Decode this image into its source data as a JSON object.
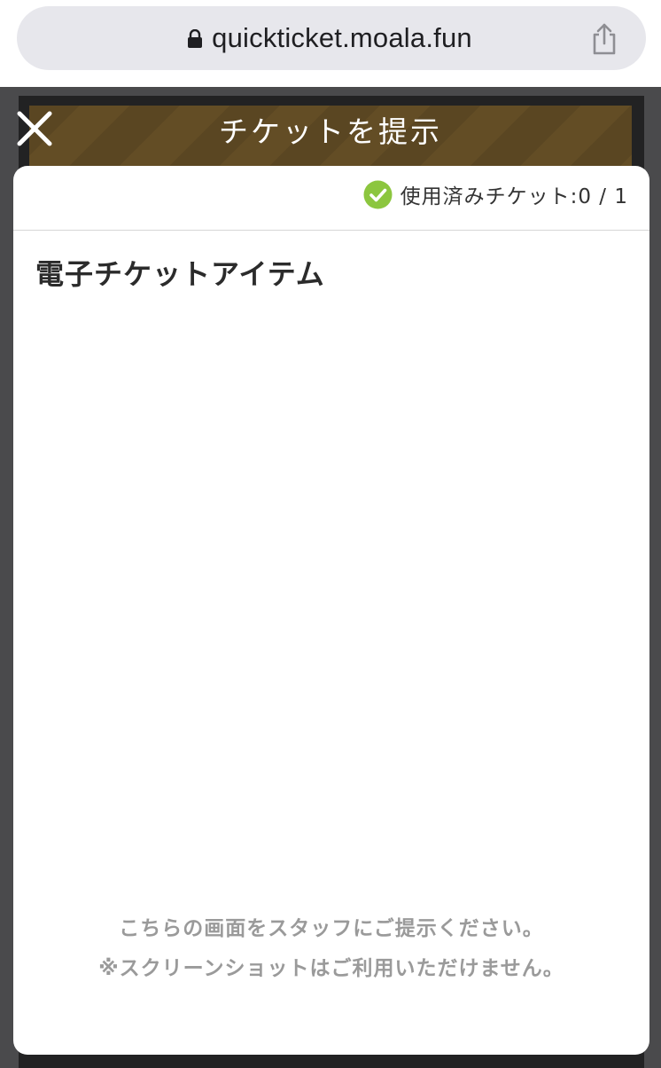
{
  "browser": {
    "url": "quickticket.moala.fun"
  },
  "header": {
    "title": "チケットを提示"
  },
  "status": {
    "label": "使用済みチケット:0 / 1",
    "used": 0,
    "total": 1
  },
  "ticket": {
    "item_title": "電子チケットアイテム"
  },
  "footer": {
    "instruction": "こちらの画面をスタッフにご提示ください。",
    "warning": "※スクリーンショットはご利用いただけません。"
  },
  "icons": {
    "lock": "lock-icon",
    "share": "share-icon",
    "close": "close-icon",
    "check": "check-circle-icon"
  },
  "colors": {
    "header_stripe": "#5a4622",
    "check_green": "#8cc63f",
    "backdrop": "#4a4a4c",
    "footer_text": "#9a9a9a"
  }
}
